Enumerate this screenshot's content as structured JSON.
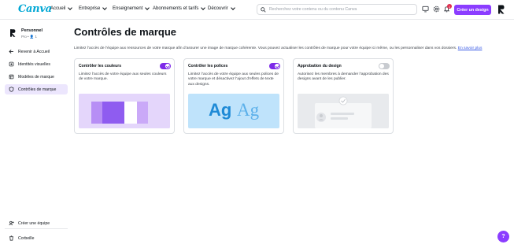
{
  "app": {
    "logo": "Canva"
  },
  "nav": [
    {
      "label": "Accueil"
    },
    {
      "label": "Entreprise"
    },
    {
      "label": "Enseignement"
    },
    {
      "label": "Abonnements et tarifs"
    },
    {
      "label": "Découvrir"
    }
  ],
  "search": {
    "placeholder": "Recherchez votre contenu ou du contenu Canva"
  },
  "notifications": {
    "count": "1"
  },
  "create_button": "Créer un design",
  "sidebar": {
    "profile": {
      "name": "Personnel",
      "sub": "Pro • 👤 1"
    },
    "items": [
      {
        "label": "Revenir à Accueil",
        "icon": "arrow-left-icon"
      },
      {
        "label": "Identités visuelles",
        "icon": "brand-kit-icon"
      },
      {
        "label": "Modèles de marque",
        "icon": "templates-icon"
      },
      {
        "label": "Contrôles de marque",
        "icon": "shield-icon",
        "active": true
      }
    ],
    "bottom": [
      {
        "label": "Créer une équipe",
        "icon": "add-team-icon"
      },
      {
        "label": "Corbeille",
        "icon": "trash-icon"
      }
    ]
  },
  "main": {
    "title": "Contrôles de marque",
    "description": "Limitez l’accès de l’équipe aux ressources de votre marque afin d’assurer une image de marque cohérente. Vous pouvez actualiser les contrôles de marque pour votre équipe ici même, ou les personnaliser dans vos dossiers.",
    "learn_more": "En savoir plus",
    "cards": [
      {
        "title": "Contrôler les couleurs",
        "text": "Limitez l’accès de votre équipe aux seules couleurs de votre marque.",
        "enabled": true
      },
      {
        "title": "Contrôler les polices",
        "text": "Limitez l’accès de votre équipe aux seules polices de votre marque et désactivez l’ajout d’effets de texte aux designs.",
        "enabled": true,
        "sample": "Ag"
      },
      {
        "title": "Approbation du design",
        "text": "Autorisez les membres à demander l’approbation des designs avant de les publier.",
        "enabled": false
      }
    ]
  },
  "colors": {
    "accent": "#8b3dff",
    "toggle_on": "#7d2ae8",
    "logo": "#00a7d4"
  }
}
